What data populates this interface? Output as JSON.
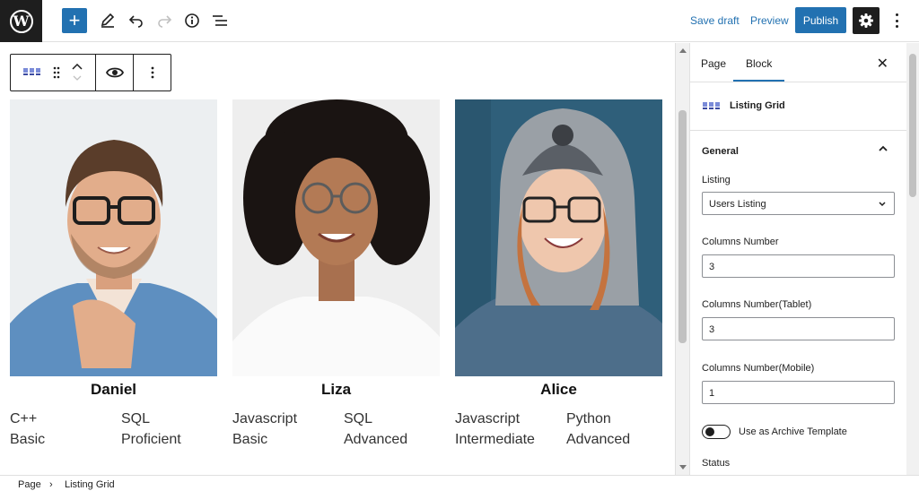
{
  "topbar": {
    "save_draft": "Save draft",
    "preview": "Preview",
    "publish": "Publish"
  },
  "block_toolbar": {
    "block_icon": "listing-grid-icon",
    "drag_icon": "drag-handle-icon",
    "move_icon": "move-up-down-icon",
    "preview_icon": "eye-icon",
    "more_icon": "more-vertical-icon"
  },
  "listing": [
    {
      "name": "Daniel",
      "skills": [
        {
          "language": "C++",
          "level": "Basic"
        },
        {
          "language": "SQL",
          "level": "Proficient"
        }
      ]
    },
    {
      "name": "Liza",
      "skills": [
        {
          "language": "Javascript",
          "level": "Basic"
        },
        {
          "language": "SQL",
          "level": "Advanced"
        }
      ]
    },
    {
      "name": "Alice",
      "skills": [
        {
          "language": "Javascript",
          "level": "Intermediate"
        },
        {
          "language": "Python",
          "level": "Advanced"
        }
      ]
    }
  ],
  "sidebar": {
    "tabs": [
      "Page",
      "Block"
    ],
    "active_tab": "Block",
    "block_name": "Listing Grid",
    "panel_title": "General",
    "fields": {
      "listing_label": "Listing",
      "listing_value": "Users Listing",
      "columns_label": "Columns Number",
      "columns_value": "3",
      "columns_tablet_label": "Columns Number(Tablet)",
      "columns_tablet_value": "3",
      "columns_mobile_label": "Columns Number(Mobile)",
      "columns_mobile_value": "1",
      "archive_toggle_label": "Use as Archive Template",
      "status_label": "Status"
    }
  },
  "breadcrumb": {
    "root": "Page",
    "current": "Listing Grid"
  },
  "colors": {
    "accent": "#2271b1",
    "dark": "#1e1e1e",
    "border": "#e0e0e0"
  }
}
